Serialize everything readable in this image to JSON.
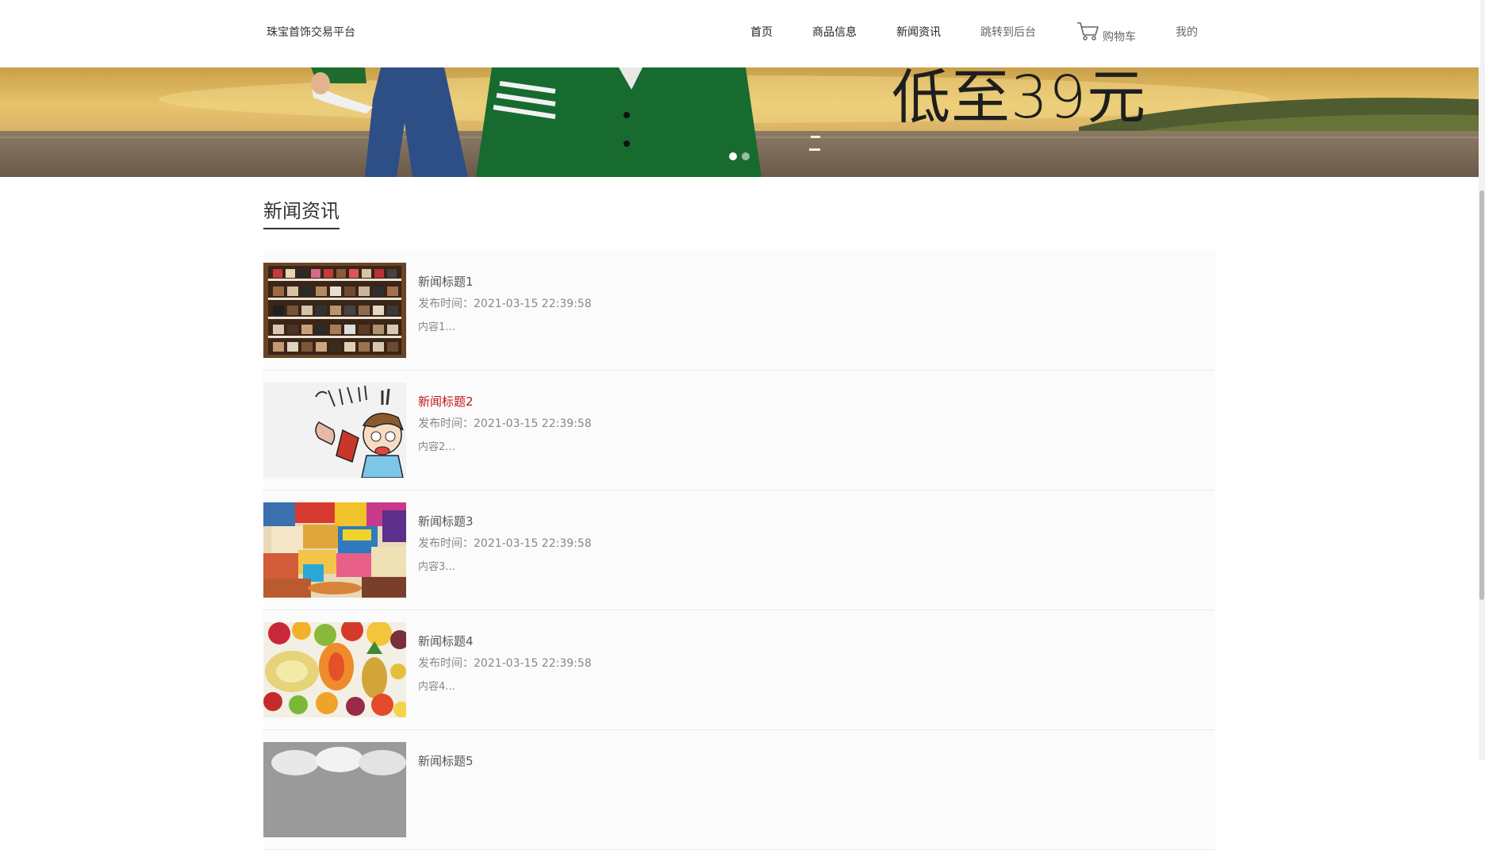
{
  "header": {
    "site_title": "珠宝首饰交易平台",
    "nav": {
      "home": "首页",
      "products": "商品信息",
      "news": "新闻资讯",
      "backend": "跳转到后台",
      "cart": "购物车",
      "mine": "我的"
    }
  },
  "banner": {
    "promo_text": "低至39元",
    "slides_count": 2,
    "active_slide": 1
  },
  "section": {
    "title": "新闻资讯"
  },
  "news": [
    {
      "title": "新闻标题1",
      "date": "发布时间：2021-03-15 22:39:58",
      "content": "内容1...",
      "thumb": "shoe-shelf-image"
    },
    {
      "title": "新闻标题2",
      "date": "发布时间：2021-03-15 22:39:58",
      "content": "内容2...",
      "thumb": "cartoon-shopping-image"
    },
    {
      "title": "新闻标题3",
      "date": "发布时间：2021-03-15 22:39:58",
      "content": "内容3...",
      "thumb": "snacks-image"
    },
    {
      "title": "新闻标题4",
      "date": "发布时间：2021-03-15 22:39:58",
      "content": "内容4...",
      "thumb": "fruits-image"
    },
    {
      "title": "新闻标题5",
      "date": "",
      "content": "",
      "thumb": "pillows-image"
    }
  ],
  "colors": {
    "accent_red": "#c0161c",
    "text_dark": "#333333",
    "text_muted": "#888888"
  }
}
